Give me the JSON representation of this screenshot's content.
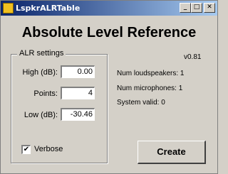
{
  "window": {
    "title": "LspkrALRTable",
    "minimize_glyph": "_",
    "maximize_glyph": "□",
    "close_glyph": "✕"
  },
  "heading": "Absolute Level Reference",
  "alr_settings": {
    "group_title": "ALR settings",
    "high_label": "High (dB):",
    "high_value": "0.00",
    "points_label": "Points:",
    "points_value": "4",
    "low_label": "Low (dB):",
    "low_value": "-30.46",
    "verbose_label": "Verbose",
    "verbose_checked_glyph": "✔"
  },
  "info": {
    "version": "v0.81",
    "num_loudspeakers": "Num loudspeakers: 1",
    "num_microphones": "Num microphones: 1",
    "system_valid": "System valid: 0"
  },
  "create_button_label": "Create"
}
